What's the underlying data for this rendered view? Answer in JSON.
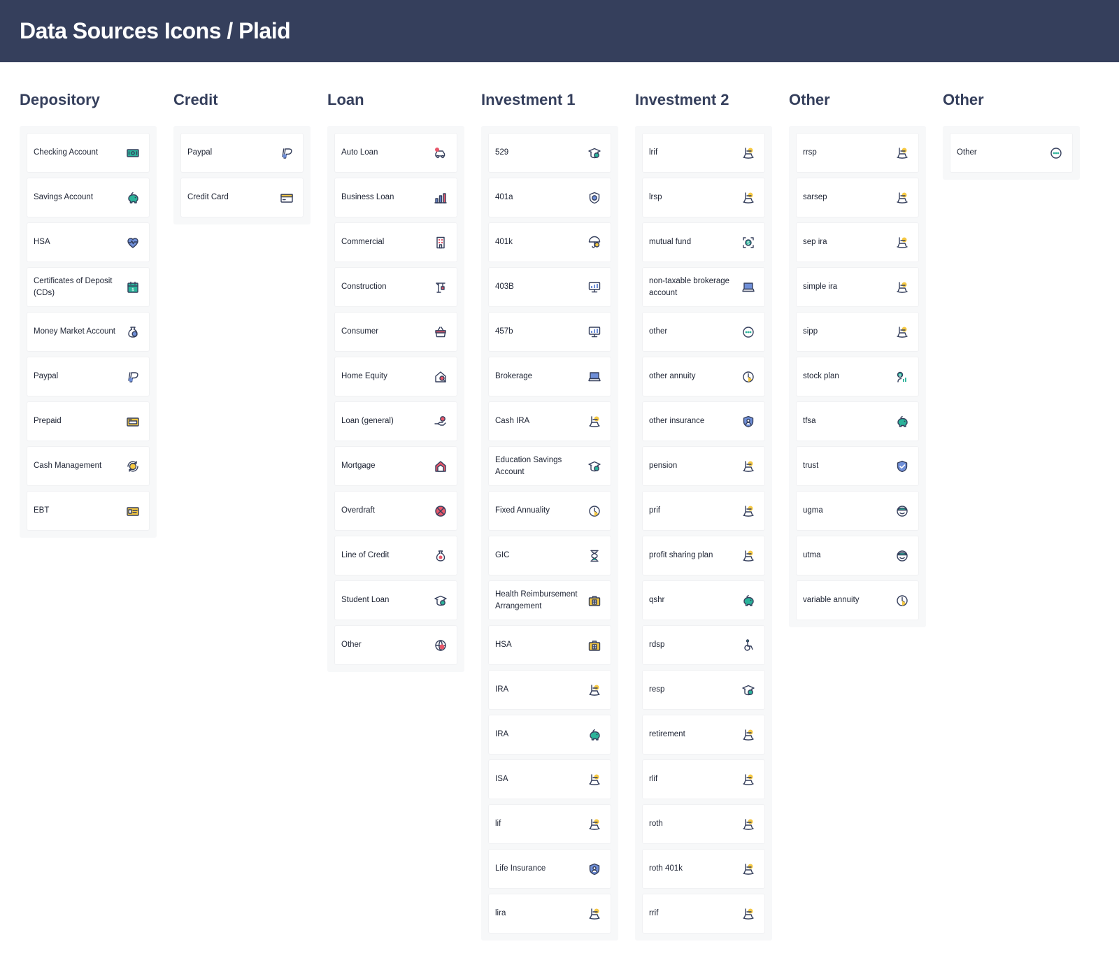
{
  "header": {
    "title": "Data Sources Icons / Plaid"
  },
  "columns": [
    {
      "title": "Depository",
      "items": [
        {
          "label": "Checking Account",
          "icon": "cash-icon"
        },
        {
          "label": "Savings Account",
          "icon": "piggy-bank-icon"
        },
        {
          "label": "HSA",
          "icon": "heart-pulse-icon"
        },
        {
          "label": "Certificates of Deposit (CDs)",
          "icon": "calendar-icon"
        },
        {
          "label": "Money Market Account",
          "icon": "coin-bag-icon"
        },
        {
          "label": "Paypal",
          "icon": "paypal-icon"
        },
        {
          "label": "Prepaid",
          "icon": "prepaid-card-icon"
        },
        {
          "label": "Cash Management",
          "icon": "coin-exchange-icon"
        },
        {
          "label": "EBT",
          "icon": "id-card-icon"
        }
      ]
    },
    {
      "title": "Credit",
      "items": [
        {
          "label": "Paypal",
          "icon": "paypal-icon"
        },
        {
          "label": "Credit Card",
          "icon": "credit-card-icon"
        }
      ]
    },
    {
      "title": "Loan",
      "items": [
        {
          "label": "Auto Loan",
          "icon": "car-icon"
        },
        {
          "label": "Business Loan",
          "icon": "bar-chart-icon"
        },
        {
          "label": "Commercial",
          "icon": "building-icon"
        },
        {
          "label": "Construction",
          "icon": "crane-icon"
        },
        {
          "label": "Consumer",
          "icon": "basket-icon"
        },
        {
          "label": "Home Equity",
          "icon": "house-search-icon"
        },
        {
          "label": "Loan (general)",
          "icon": "hand-coin-icon"
        },
        {
          "label": "Mortgage",
          "icon": "house-icon"
        },
        {
          "label": "Overdraft",
          "icon": "no-entry-icon"
        },
        {
          "label": "Line of Credit",
          "icon": "money-bag-icon"
        },
        {
          "label": "Student Loan",
          "icon": "graduation-cap-icon"
        },
        {
          "label": "Other",
          "icon": "globe-icon"
        }
      ]
    },
    {
      "title": "Investment 1",
      "items": [
        {
          "label": "529",
          "icon": "graduation-cap-icon"
        },
        {
          "label": "401a",
          "icon": "shield-coin-icon"
        },
        {
          "label": "401k",
          "icon": "umbrella-icon"
        },
        {
          "label": "403B",
          "icon": "monitor-chart-icon"
        },
        {
          "label": "457b",
          "icon": "monitor-chart-icon"
        },
        {
          "label": "Brokerage",
          "icon": "laptop-icon"
        },
        {
          "label": "Cash IRA",
          "icon": "rocking-chair-icon"
        },
        {
          "label": "Education Savings Account",
          "icon": "graduation-cap-icon"
        },
        {
          "label": "Fixed Annuality",
          "icon": "clock-icon"
        },
        {
          "label": "GIC",
          "icon": "hourglass-icon"
        },
        {
          "label": "Health Reimbursement Arrangement",
          "icon": "medical-kit-icon"
        },
        {
          "label": "HSA",
          "icon": "medical-kit-icon"
        },
        {
          "label": "IRA",
          "icon": "rocking-chair-icon"
        },
        {
          "label": "IRA",
          "icon": "piggy-bank-icon"
        },
        {
          "label": "ISA",
          "icon": "rocking-chair-icon"
        },
        {
          "label": "lif",
          "icon": "rocking-chair-icon"
        },
        {
          "label": "Life Insurance",
          "icon": "shield-user-icon"
        },
        {
          "label": "lira",
          "icon": "rocking-chair-icon"
        }
      ]
    },
    {
      "title": "Investment 2",
      "items": [
        {
          "label": "lrif",
          "icon": "rocking-chair-icon"
        },
        {
          "label": "lrsp",
          "icon": "rocking-chair-icon"
        },
        {
          "label": "mutual fund",
          "icon": "target-coin-icon"
        },
        {
          "label": "non-taxable brokerage account",
          "icon": "laptop-icon"
        },
        {
          "label": "other",
          "icon": "more-icon"
        },
        {
          "label": "other annuity",
          "icon": "clock-icon"
        },
        {
          "label": "other insurance",
          "icon": "shield-user-icon"
        },
        {
          "label": "pension",
          "icon": "rocking-chair-icon"
        },
        {
          "label": "prif",
          "icon": "rocking-chair-icon"
        },
        {
          "label": "profit sharing plan",
          "icon": "rocking-chair-icon"
        },
        {
          "label": "qshr",
          "icon": "piggy-bank-icon"
        },
        {
          "label": "rdsp",
          "icon": "wheelchair-icon"
        },
        {
          "label": "resp",
          "icon": "graduation-cap-icon"
        },
        {
          "label": "retirement",
          "icon": "rocking-chair-icon"
        },
        {
          "label": "rlif",
          "icon": "rocking-chair-icon"
        },
        {
          "label": "roth",
          "icon": "rocking-chair-icon"
        },
        {
          "label": "roth 401k",
          "icon": "rocking-chair-icon"
        },
        {
          "label": "rrif",
          "icon": "rocking-chair-icon"
        }
      ]
    },
    {
      "title": "Other",
      "items": [
        {
          "label": "rrsp",
          "icon": "rocking-chair-icon"
        },
        {
          "label": "sarsep",
          "icon": "rocking-chair-icon"
        },
        {
          "label": "sep ira",
          "icon": "rocking-chair-icon"
        },
        {
          "label": "simple ira",
          "icon": "rocking-chair-icon"
        },
        {
          "label": "sipp",
          "icon": "rocking-chair-icon"
        },
        {
          "label": "stock plan",
          "icon": "person-chart-icon"
        },
        {
          "label": "tfsa",
          "icon": "piggy-bank-icon"
        },
        {
          "label": "trust",
          "icon": "shield-check-icon"
        },
        {
          "label": "ugma",
          "icon": "kid-icon"
        },
        {
          "label": "utma",
          "icon": "kid-icon"
        },
        {
          "label": "variable annuity",
          "icon": "clock-icon"
        }
      ]
    },
    {
      "title": "Other",
      "items": [
        {
          "label": "Other",
          "icon": "more-icon"
        }
      ]
    }
  ],
  "colors": {
    "header_bg": "#353f5c",
    "heading": "#353f5c",
    "panel_bg": "#f7f8f9",
    "icon_navy": "#353f5c",
    "icon_yellow": "#f5c842",
    "icon_teal": "#2bb39a",
    "icon_blue": "#6f8fd8",
    "icon_red": "#e8576a"
  }
}
